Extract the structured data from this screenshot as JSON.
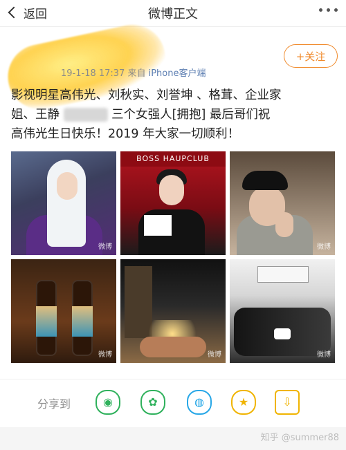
{
  "topbar": {
    "back_label": "返回",
    "title": "微博正文"
  },
  "header": {
    "meta_prefix": "19-1-18 17:37  来自",
    "meta_source": "iPhone客户端",
    "follow_label": "+关注"
  },
  "post": {
    "line1": "影视明星高伟光、刘秋实、刘誉坤 、格茸、企业家",
    "line2a": "姐、王静",
    "line2b": "三个女强人[拥抱] 最后哥们祝",
    "line3": "高伟光生日快乐！2019 年大家一切顺利！"
  },
  "images": {
    "tile2_banner": "BOSS HAUPCLUB",
    "watermark": "微博"
  },
  "share": {
    "label": "分享到",
    "icons": [
      "wechat-icon",
      "moments-icon",
      "qq-icon",
      "qzone-icon",
      "save-image-icon"
    ]
  },
  "footer": {
    "watermark": "知乎 @summer88"
  }
}
